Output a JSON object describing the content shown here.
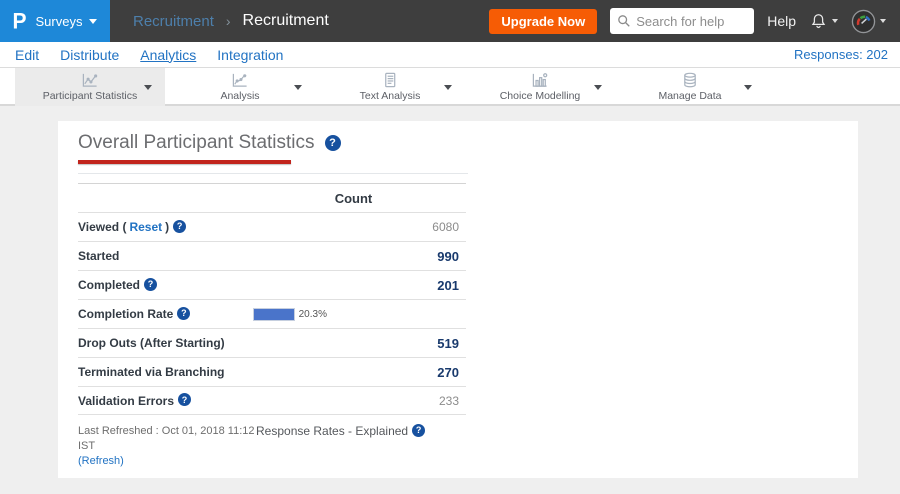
{
  "topbar": {
    "logo_letter": "P",
    "product_menu": "Surveys",
    "breadcrumb": {
      "parent": "Recruitment",
      "current": "Recruitment"
    },
    "upgrade_label": "Upgrade Now",
    "search_placeholder": "Search for help",
    "help_label": "Help"
  },
  "nav": {
    "tabs": [
      {
        "label": "Edit"
      },
      {
        "label": "Distribute"
      },
      {
        "label": "Analytics",
        "active": true
      },
      {
        "label": "Integration"
      }
    ],
    "responses_label": "Responses: 202"
  },
  "toolbar": {
    "tabs": [
      {
        "label": "Participant Statistics",
        "icon": "line-chart-icon",
        "active": true
      },
      {
        "label": "Analysis",
        "icon": "scatter-chart-icon",
        "active": false
      },
      {
        "label": "Text Analysis",
        "icon": "document-icon",
        "active": false
      },
      {
        "label": "Choice Modelling",
        "icon": "bar-chart-icon",
        "active": false
      },
      {
        "label": "Manage Data",
        "icon": "database-icon",
        "active": false
      }
    ]
  },
  "main": {
    "title": "Overall Participant Statistics",
    "table": {
      "count_header": "Count",
      "rows": [
        {
          "prefix": "Viewed (",
          "link": "Reset",
          "suffix": ")",
          "help": true,
          "value": "6080",
          "style": "muted"
        },
        {
          "prefix": "Started",
          "help": false,
          "value": "990",
          "style": "strong"
        },
        {
          "prefix": "Completed",
          "help": true,
          "value": "201",
          "style": "strong"
        },
        {
          "prefix": "Completion Rate",
          "help": true,
          "bar_percent": "20.3%",
          "style": "bar"
        },
        {
          "prefix": "Drop Outs (After Starting)",
          "help": false,
          "value": "519",
          "style": "strong"
        },
        {
          "prefix": "Terminated via Branching",
          "help": false,
          "value": "270",
          "style": "strong"
        },
        {
          "prefix": "Validation Errors",
          "help": true,
          "value": "233",
          "style": "muted"
        }
      ]
    },
    "footer": {
      "last_refreshed": "Last Refreshed : Oct 01, 2018 11:12 IST",
      "refresh_link": "(Refresh)",
      "response_rates_label": "Response Rates - Explained"
    }
  },
  "icons": {
    "help": "?",
    "breadcrumb_chevron": "›"
  },
  "colors": {
    "accent": "#2273c3",
    "topbar_bg": "#3e3e3e",
    "logo_bg": "#1e88d8",
    "upgrade_orange": "#f65c05",
    "title_red": "#c1241c",
    "bar_blue": "#4a74ca",
    "value_navy": "#193a6d"
  }
}
